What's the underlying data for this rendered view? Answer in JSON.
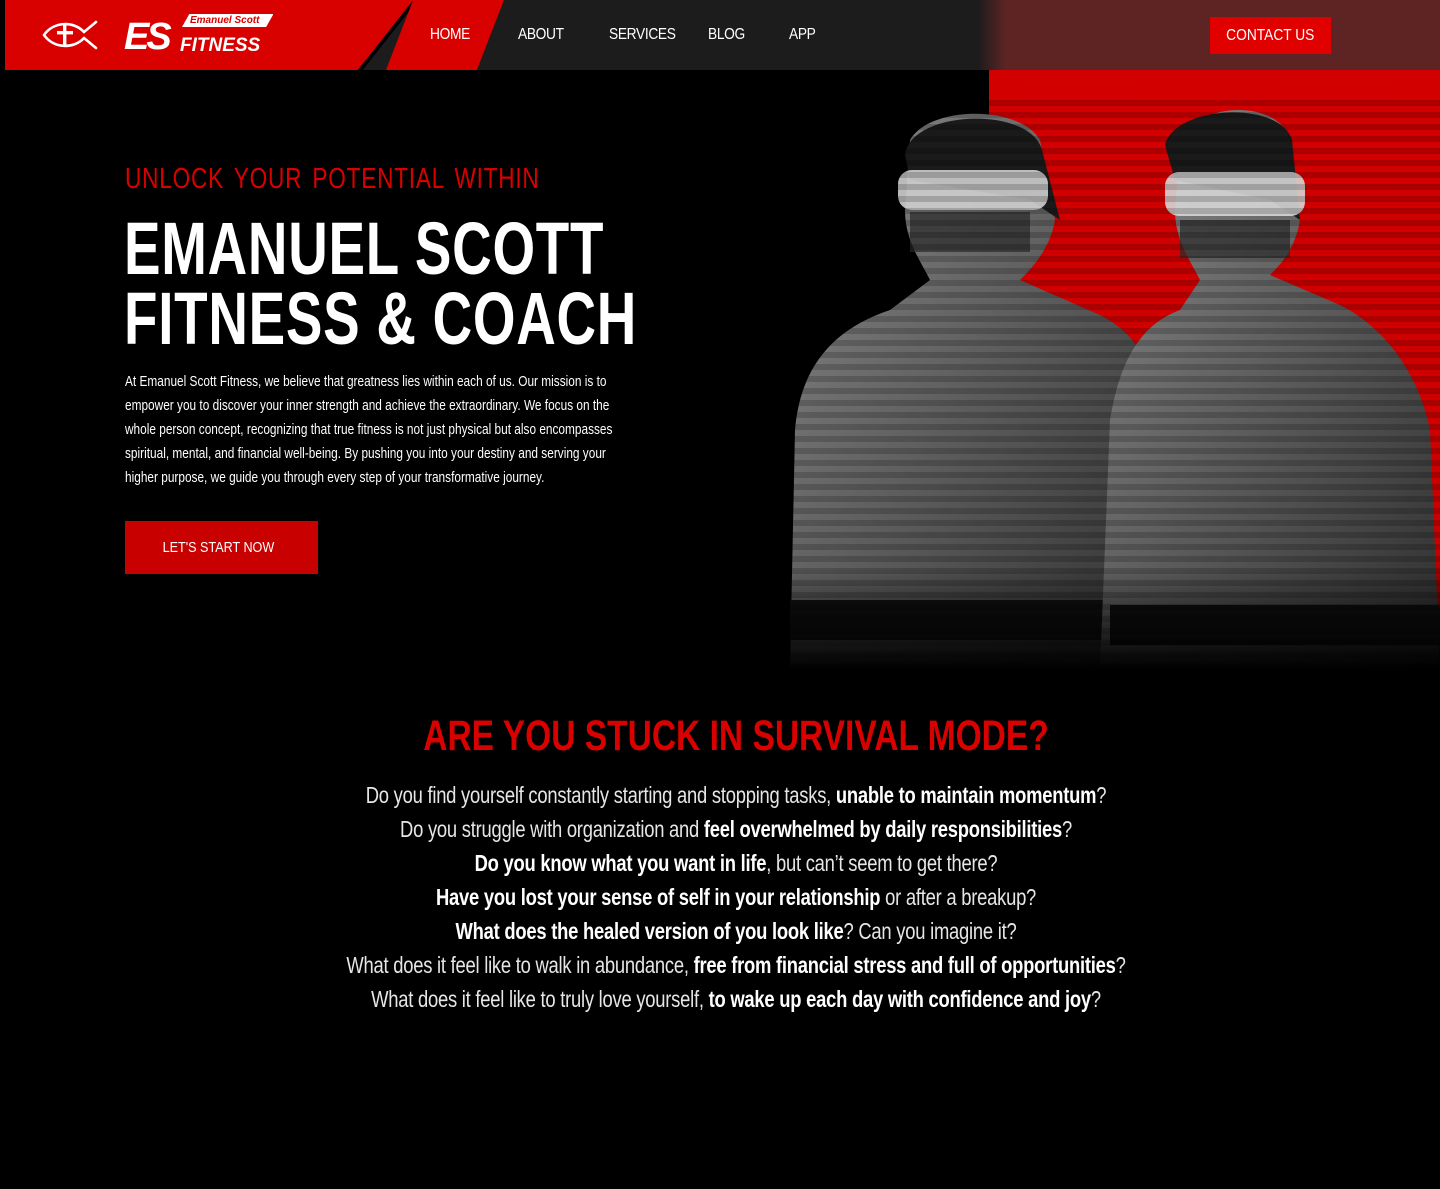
{
  "nav": {
    "brand": {
      "script": "Emanuel Scott",
      "mark": "ES",
      "word": "FITNESS"
    },
    "links": [
      "HOME",
      "ABOUT",
      "SERVICES",
      "BLOG",
      "APP"
    ],
    "contact_label": "CONTACT US"
  },
  "hero": {
    "eyebrow": "UNLOCK  YOUR  POTENTIAL  WITHIN",
    "title_line1": "EMANUEL SCOTT",
    "title_line2": "FITNESS & COACH",
    "description": "At Emanuel Scott Fitness, we believe that greatness lies within each of us. Our mission is to empower you to discover your inner strength and achieve the extraordinary. We focus on the whole person concept, recognizing that true fitness is not just physical but also encompasses spiritual, mental, and financial well-being. By pushing you into your destiny and serving your higher purpose, we guide you through every step of your transformative journey.",
    "cta_label": "LET'S START NOW"
  },
  "survival": {
    "title": "ARE YOU STUCK IN SURVIVAL MODE?",
    "questions": [
      {
        "pre": "Do you find yourself constantly starting and stopping tasks, ",
        "bold": "unable to maintain momentum",
        "post": "?"
      },
      {
        "pre": "Do you struggle with organization and ",
        "bold": "feel overwhelmed by daily responsibilities",
        "post": "?"
      },
      {
        "pre": "",
        "bold": "Do you know what you want in life",
        "post": ", but can’t seem to get there?"
      },
      {
        "pre": "",
        "bold": "Have you lost your sense of self in your relationship",
        "post": " or after a breakup?"
      },
      {
        "pre": "",
        "bold": "What does the healed version of you look like",
        "post": "? Can you imagine it?"
      },
      {
        "pre": "What does it feel like to walk in abundance, ",
        "bold": "free from financial stress and full of opportunities",
        "post": "?"
      },
      {
        "pre": "What does it feel like to truly love yourself, ",
        "bold": "to wake up each day with confidence and joy",
        "post": "?"
      }
    ]
  },
  "colors": {
    "brand_red": "#d90000",
    "nav_dark": "#1c1c1c",
    "contact_bg": "#e00000",
    "background": "#000000"
  },
  "icons": {
    "logo": "ichthys-cross-icon"
  }
}
